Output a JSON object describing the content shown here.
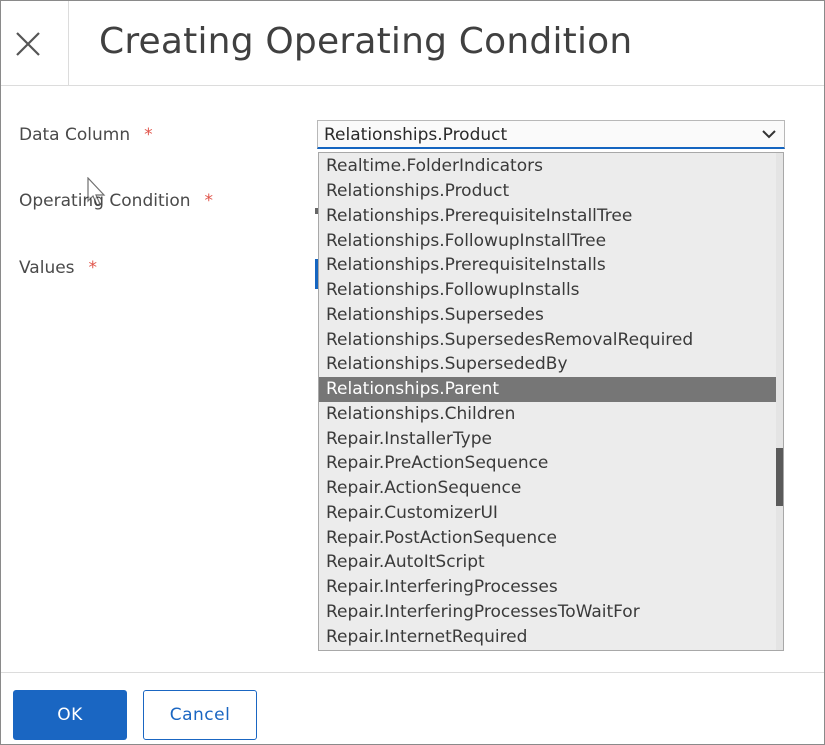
{
  "dialog": {
    "title": "Creating Operating Condition",
    "close_icon": "close-icon"
  },
  "form": {
    "fields": [
      {
        "label": "Data Column",
        "required": "*"
      },
      {
        "label": "Operating Condition",
        "required": "*"
      },
      {
        "label": "Values",
        "required": "*"
      }
    ],
    "data_column": {
      "value": "Relationships.Product",
      "chevron_icon": "chevron-down-icon",
      "options": [
        "Realtime.FolderIndicators",
        "Relationships.Product",
        "Relationships.PrerequisiteInstallTree",
        "Relationships.FollowupInstallTree",
        "Relationships.PrerequisiteInstalls",
        "Relationships.FollowupInstalls",
        "Relationships.Supersedes",
        "Relationships.SupersedesRemovalRequired",
        "Relationships.SupersededBy",
        "Relationships.Parent",
        "Relationships.Children",
        "Repair.InstallerType",
        "Repair.PreActionSequence",
        "Repair.ActionSequence",
        "Repair.CustomizerUI",
        "Repair.PostActionSequence",
        "Repair.AutoItScript",
        "Repair.InterferingProcesses",
        "Repair.InterferingProcessesToWaitFor",
        "Repair.InternetRequired"
      ],
      "highlighted_option": "Relationships.Parent",
      "scroll_position": 0.59
    }
  },
  "footer": {
    "ok_label": "OK",
    "cancel_label": "Cancel"
  },
  "colors": {
    "primary": "#1a66c2",
    "required": "#e0544a",
    "highlight": "#767676"
  }
}
